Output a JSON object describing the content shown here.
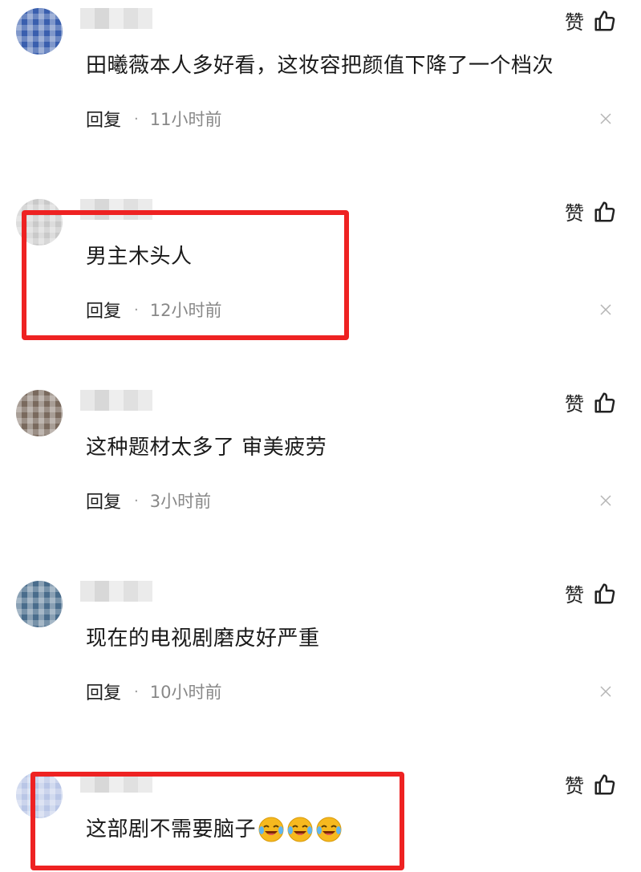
{
  "like_label": "赞",
  "reply_label": "回复",
  "separator": "·",
  "highlight_color": "#ee2222",
  "comments": [
    {
      "text": "田曦薇本人多好看，这妆容把颜值下降了一个档次",
      "time": "11小时前",
      "avatar_color": "#3a5fae",
      "highlighted": false
    },
    {
      "text": "男主木头人",
      "time": "12小时前",
      "avatar_color": "#c9c9c9",
      "highlighted": true
    },
    {
      "text": "这种题材太多了 审美疲劳",
      "time": "3小时前",
      "avatar_color": "#7a6a5e",
      "highlighted": false
    },
    {
      "text": "现在的电视剧磨皮好严重",
      "time": "10小时前",
      "avatar_color": "#4a6d8c",
      "highlighted": false
    },
    {
      "text": "这部剧不需要脑子",
      "time": "",
      "avatar_color": "#b9c6e6",
      "highlighted": true,
      "emoji_count": 3,
      "emoji_name": "laugh-cry-emoji"
    }
  ]
}
